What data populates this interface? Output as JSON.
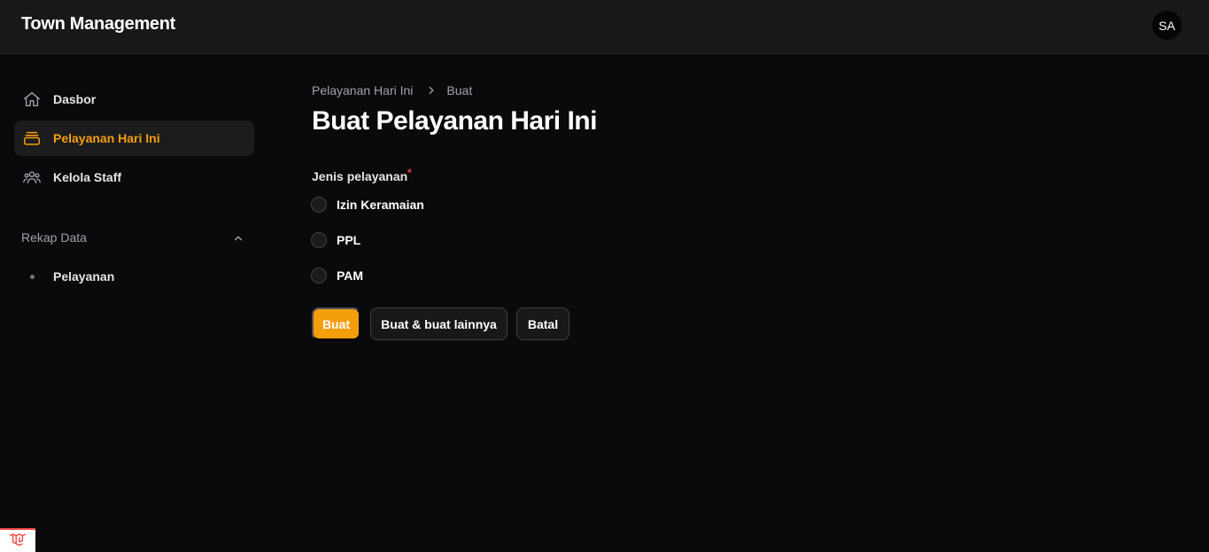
{
  "app": {
    "title": "Town Management",
    "avatar_initials": "SA"
  },
  "sidebar": {
    "items": [
      {
        "label": "Dasbor",
        "icon": "home-icon"
      },
      {
        "label": "Pelayanan Hari Ini",
        "icon": "inbox-stack-icon",
        "active": true
      },
      {
        "label": "Kelola Staff",
        "icon": "users-group-icon"
      }
    ],
    "group": {
      "label": "Rekap Data",
      "items": [
        {
          "label": "Pelayanan"
        }
      ]
    }
  },
  "breadcrumb": {
    "parent": "Pelayanan Hari Ini",
    "current": "Buat"
  },
  "page": {
    "title": "Buat Pelayanan Hari Ini"
  },
  "form": {
    "field_label": "Jenis pelayanan",
    "required_mark": "*",
    "options": [
      {
        "label": "Izin Keramaian",
        "selected": false
      },
      {
        "label": "PPL",
        "selected": false
      },
      {
        "label": "PAM",
        "selected": false
      }
    ],
    "buttons": {
      "create": "Buat",
      "create_another": "Buat & buat lainnya",
      "cancel": "Batal"
    }
  },
  "colors": {
    "accent": "#f59e0b",
    "background": "#0a0a0c",
    "topbar": "#18181b",
    "required": "#ef4444"
  }
}
